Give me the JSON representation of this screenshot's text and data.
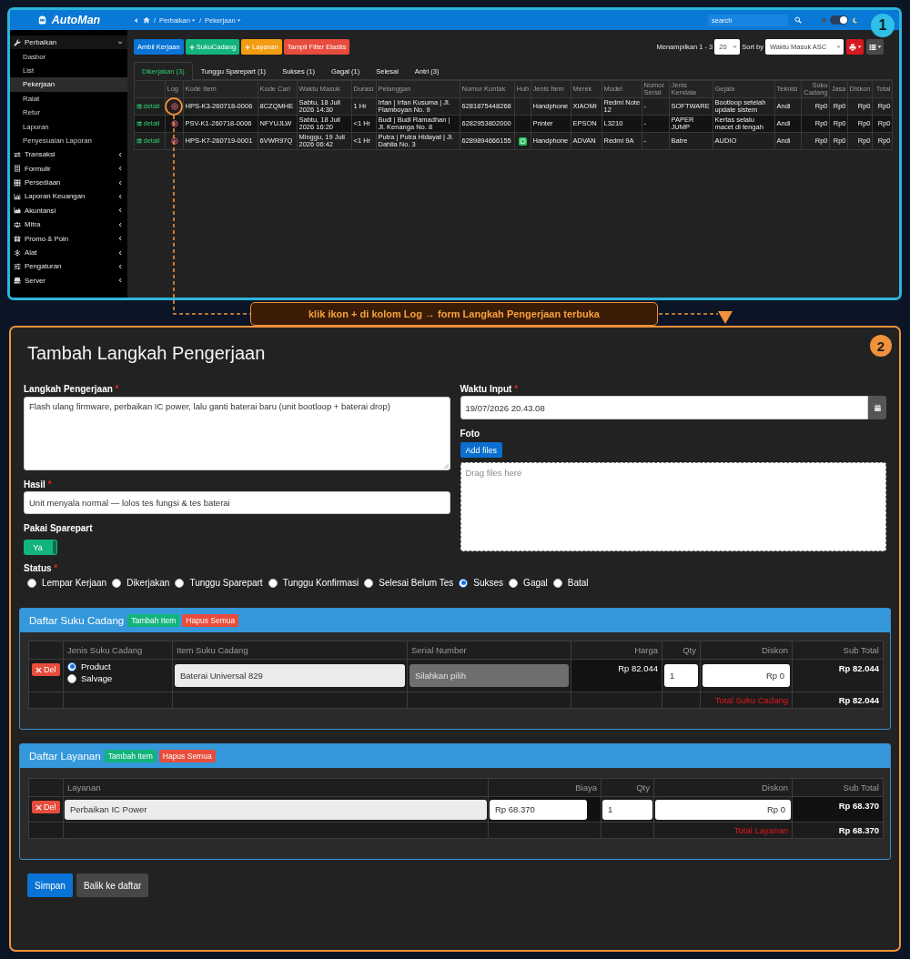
{
  "panel_1": {
    "badge": "1",
    "header": {
      "logo": "AutoMan",
      "breadcrumb": {
        "separator": "/",
        "items": [
          "Perbaikan",
          "Pekerjaan"
        ]
      },
      "search": {
        "placeholder": "search"
      },
      "dark_mode": {
        "on": true
      }
    },
    "sidebar": {
      "items": [
        {
          "label": "Perbaikan",
          "expanded": true,
          "children": [
            {
              "label": "Dasbor",
              "selected": false
            },
            {
              "label": "List",
              "selected": false
            },
            {
              "label": "Pekerjaan",
              "selected": true
            },
            {
              "label": "Ralat",
              "selected": false
            },
            {
              "label": "Retur",
              "selected": false
            },
            {
              "label": "Laporan",
              "selected": false
            },
            {
              "label": "Penyesuaian Laporan",
              "selected": false
            }
          ]
        },
        {
          "label": "Transaksi",
          "expanded": false
        },
        {
          "label": "Formulir",
          "expanded": false
        },
        {
          "label": "Persediaan",
          "expanded": false
        },
        {
          "label": "Laporan Keuangan",
          "expanded": false
        },
        {
          "label": "Akuntansi",
          "expanded": false
        },
        {
          "label": "Mitra",
          "expanded": false
        },
        {
          "label": "Promo & Poin",
          "expanded": false
        },
        {
          "label": "Alat",
          "expanded": false
        },
        {
          "label": "Pengaturan",
          "expanded": false
        },
        {
          "label": "Server",
          "expanded": false
        }
      ]
    },
    "toolbar": {
      "buttons": [
        {
          "label": "Ambil Kerjaan",
          "kind": "primary",
          "plus": false
        },
        {
          "label": "SukuCadang",
          "kind": "success",
          "plus": true
        },
        {
          "label": "Layanan",
          "kind": "warning",
          "plus": true
        },
        {
          "label": "Tampil Filter Elastis",
          "kind": "danger",
          "plus": false
        }
      ],
      "range": "Menampilkan 1 - 3",
      "page_size": "20",
      "sort_label": "Sort by",
      "sort": "Waktu Masuk ASC"
    },
    "tabs": [
      {
        "label": "Dikerjakan (3)",
        "selected": true
      },
      {
        "label": "Tunggu Sparepart (1)",
        "selected": false
      },
      {
        "label": "Sukses (1)",
        "selected": false
      },
      {
        "label": "Gagal (1)",
        "selected": false
      },
      {
        "label": "Selesai",
        "selected": false
      },
      {
        "label": "Antri (3)",
        "selected": false
      }
    ],
    "table": {
      "columns": [
        {
          "kind": "link"
        },
        {
          "label": "Log",
          "kind": "log"
        },
        {
          "label": "Kode Item",
          "kind": "text"
        },
        {
          "label": "Kode Cari",
          "kind": "text"
        },
        {
          "label": "Waktu Masuk",
          "kind": "text"
        },
        {
          "label": "Durasi",
          "kind": "text"
        },
        {
          "label": "Pelanggan",
          "kind": "text"
        },
        {
          "label": "Nomor Kontak",
          "kind": "text"
        },
        {
          "label": "Hub",
          "kind": "hub"
        },
        {
          "label": "Jenis Item",
          "kind": "text"
        },
        {
          "label": "Merek",
          "kind": "text"
        },
        {
          "label": "Model",
          "kind": "text"
        },
        {
          "label": "Nomor Serial",
          "kind": "text"
        },
        {
          "label": "Jenis Kendala",
          "kind": "text"
        },
        {
          "label": "Gejala",
          "kind": "text"
        },
        {
          "label": "Teknisi",
          "kind": "text"
        },
        {
          "label": "Suku Cadang",
          "kind": "money"
        },
        {
          "label": "Jasa",
          "kind": "money"
        },
        {
          "label": "Diskon",
          "kind": "money"
        },
        {
          "label": "Total",
          "kind": "money"
        }
      ],
      "rows": [
        {
          "hub": false,
          "cells": [
            "detail",
            "",
            "HPS-K3-260718-0006",
            "8CZQMHE",
            "Sabtu, 18 Juli 2026 14:30",
            "1 Hr",
            "Irfan | Irfan Kusuma | Jl. Flamboyan No. 9",
            "6281875448268",
            "",
            "Handphone",
            "XIAOMI",
            "Redmi Note 12",
            "-",
            "SOFTWARE",
            "Bootloop setelah update sistem",
            "Andi",
            "Rp0",
            "Rp0",
            "Rp0",
            "Rp0"
          ]
        },
        {
          "hub": false,
          "cells": [
            "detail",
            "",
            "PSV-K1-260718-0006",
            "NFYUJLW",
            "Sabtu, 18 Juli 2026 16:20",
            "<1 Hr",
            "Budi | Budi Ramadhan | Jl. Kenanga No. 8",
            "6282953802000",
            "",
            "Printer",
            "EPSON",
            "L3210",
            "-",
            "PAPER JUMP",
            "Kertas selalu macet di tengah",
            "Andi",
            "Rp0",
            "Rp0",
            "Rp0",
            "Rp0"
          ]
        },
        {
          "hub": true,
          "cells": [
            "detail",
            "",
            "HPS-K7-260719-0001",
            "6VWR97Q",
            "Minggu, 19 Juli 2026 06:42",
            "<1 Hr",
            "Putra | Putra Hidayat | Jl. Dahlia No. 3",
            "6289894666155",
            "",
            "Handphone",
            "ADVAN",
            "Redmi 9A",
            "-",
            "Batre",
            "AUDIO",
            "Andi",
            "Rp0",
            "Rp0",
            "Rp0",
            "Rp0"
          ]
        }
      ]
    }
  },
  "callout": {
    "text": "klik ikon + di kolom Log → form Langkah Pengerjaan terbuka"
  },
  "panel_2": {
    "badge": "2",
    "title": "Tambah Langkah Pengerjaan",
    "form": {
      "langkah": {
        "label": "Langkah Pengerjaan",
        "mark": "*",
        "value": "Flash ulang firmware, perbaikan IC power, lalu ganti baterai baru (unit bootloop + baterai drop)"
      },
      "hasil": {
        "label": "Hasil",
        "mark": "*",
        "value": "Unit menyala normal — lolos tes fungsi & tes baterai"
      },
      "pakai_sparepart": {
        "label": "Pakai Sparepart",
        "on": true,
        "text": "Ya"
      },
      "waktu_input": {
        "label": "Waktu Input",
        "mark": "*",
        "value": "19/07/2026 20.43.08"
      },
      "foto": {
        "label": "Foto",
        "button": "Add files",
        "placeholder": "Drag files here"
      }
    },
    "status": {
      "label": "Status",
      "mark": "*",
      "options": [
        {
          "label": "Lempar Kerjaan",
          "selected": false
        },
        {
          "label": "Dikerjakan",
          "selected": false
        },
        {
          "label": "Tunggu Sparepart",
          "selected": false
        },
        {
          "label": "Tunggu Konfirmasi",
          "selected": false
        },
        {
          "label": "Selesai Belum Tes",
          "selected": false
        },
        {
          "label": "Sukses",
          "selected": true
        },
        {
          "label": "Gagal",
          "selected": false
        },
        {
          "label": "Batal",
          "selected": false
        }
      ]
    },
    "parts": {
      "title": "Daftar Suku Cadang",
      "add": "Tambah Item",
      "clear": "Hapus Semua",
      "columns": [
        {
          "label": "Jenis Suku Cadang",
          "kind": "text"
        },
        {
          "label": "Item Suku Cadang",
          "kind": "text"
        },
        {
          "label": "Serial Number",
          "kind": "text"
        },
        {
          "label": "Harga",
          "kind": "number"
        },
        {
          "label": "Qty",
          "kind": "number"
        },
        {
          "label": "Diskon",
          "kind": "number"
        },
        {
          "label": "Sub Total",
          "kind": "number"
        }
      ],
      "rows": [
        {
          "delete": "Del",
          "types": [
            {
              "label": "Product",
              "selected": true
            },
            {
              "label": "Salvage",
              "selected": false
            }
          ],
          "item": "Baterai Universal 829",
          "serial": {
            "placeholder": "Silahkan pilih"
          },
          "price": "Rp 82.044",
          "qty": "1",
          "discount": "Rp 0",
          "subtotal": "Rp 82.044"
        }
      ],
      "total_label": "Total Suku Cadang",
      "total": "Rp 82.044"
    },
    "services": {
      "title": "Daftar Layanan",
      "add": "Tambah Item",
      "clear": "Hapus Semua",
      "columns": [
        {
          "label": "Layanan",
          "kind": "text"
        },
        {
          "label": "Biaya",
          "kind": "number"
        },
        {
          "label": "Qty",
          "kind": "number"
        },
        {
          "label": "Diskon",
          "kind": "number"
        },
        {
          "label": "Sub Total",
          "kind": "number"
        }
      ],
      "rows": [
        {
          "delete": "Del",
          "service": "Perbaikan IC Power",
          "price": "Rp 68.370",
          "qty": "1",
          "discount": "Rp 0",
          "subtotal": "Rp 68.370"
        }
      ],
      "total_label": "Total Layanan",
      "total": "Rp 68.370"
    },
    "buttons": [
      {
        "label": "Simpan",
        "kind": "primary"
      },
      {
        "label": "Balik ke daftar",
        "kind": "secondary"
      }
    ]
  }
}
